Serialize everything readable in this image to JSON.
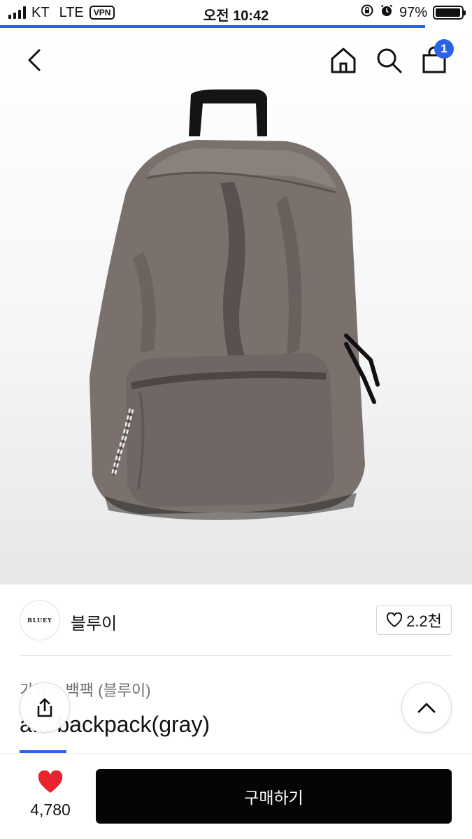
{
  "status_bar": {
    "carrier": "KT",
    "network": "LTE",
    "vpn_label": "VPN",
    "time": "오전 10:42",
    "battery_percent": "97%",
    "battery_level": 0.97,
    "page_load_progress": 0.9
  },
  "top_nav": {
    "icons": [
      "back-icon",
      "home-icon",
      "search-icon",
      "shopping-bag-icon"
    ],
    "cart_count": "1"
  },
  "product_image": {
    "subject": "gray canvas backpack",
    "main_color": "#7a716d"
  },
  "seller": {
    "logo_text": "BLUEY",
    "name": "블루이",
    "likes": "2.2천"
  },
  "product": {
    "breadcrumb": "가방 > 백팩 (블루이)",
    "title": "a... backpack(gray)"
  },
  "floating": {
    "share_icon": "share-icon",
    "scroll_top_icon": "chevron-up-icon"
  },
  "bottom_bar": {
    "wish_count": "4,780",
    "buy_label": "구매하기",
    "heart_color": "#e8242e"
  },
  "colors": {
    "accent": "#2a63e6",
    "buy_button": "#050505"
  }
}
